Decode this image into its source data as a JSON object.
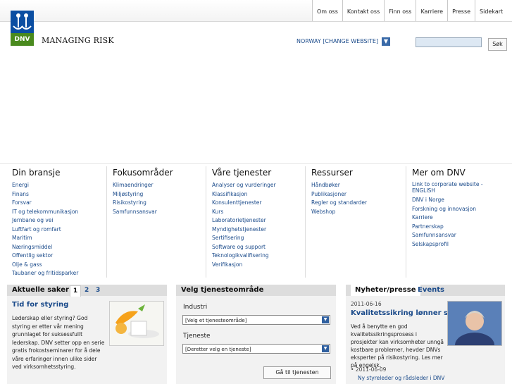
{
  "topnav": [
    "Om oss",
    "Kontakt oss",
    "Finn oss",
    "Karriere",
    "Presse",
    "Sidekart"
  ],
  "logo": {
    "text": "DNV",
    "tagline": "MANAGING RISK"
  },
  "country": "NORWAY [CHANGE WEBSITE]",
  "search": {
    "button": "Søk",
    "placeholder": ""
  },
  "menu": [
    {
      "title": "Din bransje",
      "links": [
        "Energi",
        "Finans",
        "Forsvar",
        "IT og telekommunikasjon",
        "Jernbane og vei",
        "Luftfart og romfart",
        "Maritim",
        "Næringsmiddel",
        "Offentlig sektor",
        "Olje & gass",
        "Taubaner og fritidsparker"
      ]
    },
    {
      "title": "Fokusområder",
      "links": [
        "Klimaendringer",
        "Miljøstyring",
        "Risikostyring",
        "Samfunnsansvar"
      ]
    },
    {
      "title": "Våre tjenester",
      "links": [
        "Analyser og vurderinger",
        "Klassifikasjon",
        "Konsulenttjenester",
        "Kurs",
        "Laboratorietjenester",
        "Myndighetstjenester",
        "Sertifisering",
        "Software og support",
        "Teknologikvalifisering",
        "Verifikasjon"
      ]
    },
    {
      "title": "Ressurser",
      "links": [
        "Håndbøker",
        "Publikasjoner",
        "Regler og standarder",
        "Webshop"
      ]
    },
    {
      "title": "Mer om DNV",
      "links": [
        "Link to corporate website - ENGLISH",
        "DNV i Norge",
        "Forskning og innovasjon",
        "Karriere",
        "Partnerskap",
        "Samfunnsansvar",
        "Selskapsprofil"
      ]
    }
  ],
  "aktuelle": {
    "title": "Aktuelle saker",
    "pages": [
      "1",
      "2",
      "3"
    ],
    "headline": "Tid for styring",
    "body": "Lederskap eller styring? God styring er etter vår mening grunnlaget for suksessfullt lederskap. DNV setter opp en serie gratis frokostseminarer for å dele våre erfaringer innen ulike sider ved virksomhetsstyring."
  },
  "tjeneste": {
    "title": "Velg tjenesteområde",
    "label1": "Industri",
    "select1": "[Velg et tjenesteområde]",
    "label2": "Tjeneste",
    "select2": "[Deretter velg en tjeneste]",
    "button": "Gå til tjenesten"
  },
  "news": {
    "tab1": "Nyheter/presse",
    "tab2": "Events",
    "date1": "2011-06-16",
    "headline": "Kvalitetssikring lønner seg",
    "body": "Ved å benytte en god kvalitetssikringsprosess i prosjekter kan virksomheter unngå kostbare problemer, hevder DNVs eksperter på risikostyring. Les mer på engelsk.",
    "date2": "2011-06-09",
    "headline2": "Ny styreleder og rådsleder i DNV"
  }
}
